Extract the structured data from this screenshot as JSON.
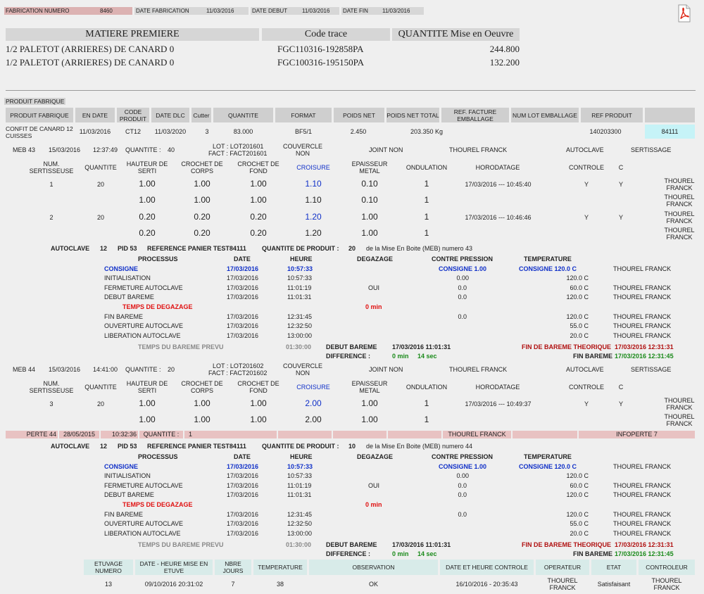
{
  "header": {
    "fab_num_label": "FABRICATION NUMERO",
    "fab_num_value": "8460",
    "date_fab_label": "DATE FABRICATION",
    "date_fab_value": "11/03/2016",
    "date_debut_label": "DATE DEBUT",
    "date_debut_value": "11/03/2016",
    "date_fin_label": "DATE FIN",
    "date_fin_value": "11/03/2016"
  },
  "matiere": {
    "headers": [
      "MATIERE PREMIERE",
      "Code trace",
      "QUANTITE Mise en Oeuvre"
    ],
    "rows": [
      {
        "name": "1/2 PALETOT (ARRIERES) DE CANARD 0",
        "code": "FGC110316-192858PA",
        "qty": "244.800"
      },
      {
        "name": "1/2 PALETOT (ARRIERES) DE CANARD 0",
        "code": "FGC100316-195150PA",
        "qty": "132.200"
      }
    ]
  },
  "produit": {
    "section_label": "PRODUIT FABRIQUE",
    "headers": [
      "PRODUIT FABRIQUE",
      "EN DATE",
      "CODE PRODUIT",
      "DATE DLC",
      "Cutter",
      "QUANTITE",
      "FORMAT",
      "POIDS NET",
      "POIDS NET TOTAL",
      "REF. FACTURE EMBALLAGE",
      "NUM LOT EMBALLAGE",
      "REF PRODUIT",
      ""
    ],
    "row": [
      "CONFIT DE CANARD 12 CUISSES",
      "11/03/2016",
      "CT12",
      "11/03/2020",
      "3",
      "83.000",
      "BF5/1",
      "2.450",
      "203.350 Kg",
      "",
      "",
      "140203300",
      "84111"
    ]
  },
  "meb1": {
    "meb": "MEB 43",
    "date": "15/03/2016",
    "time": "12:37:49",
    "qty_label": "QUANTITE :",
    "qty": "40",
    "lot": "LOT :  LOT201601",
    "fact": "FACT :  FACT201601",
    "couv_label": "COUVERCLE",
    "couv": "NON",
    "joint": "JOINT NON",
    "operator": "THOUREL FRANCK",
    "autoclave": "AUTOCLAVE",
    "sertissage": "SERTISSAGE",
    "headers": [
      "NUM. SERTISSEUSE",
      "QUANTITE",
      "HAUTEUR DE SERTI",
      "CROCHET DE CORPS",
      "CROCHET DE FOND",
      "CROISURE",
      "EPAISSEUR METAL",
      "ONDULATION",
      "HORODATAGE",
      "CONTROLE",
      "C"
    ],
    "rows": [
      [
        "1",
        "20",
        "1.00",
        "1.00",
        "1.00",
        "1.10",
        "0.10",
        "1",
        "17/03/2016 --- 10:45:40",
        "Y",
        "Y",
        "THOUREL FRANCK"
      ],
      [
        "",
        "",
        "1.00",
        "1.00",
        "1.00",
        "1.10",
        "0.10",
        "1",
        "",
        "",
        "",
        "THOUREL FRANCK"
      ],
      [
        "2",
        "20",
        "0.20",
        "0.20",
        "0.20",
        "1.20",
        "1.00",
        "1",
        "17/03/2016 --- 10:46:46",
        "Y",
        "Y",
        "THOUREL FRANCK"
      ],
      [
        "",
        "",
        "0.20",
        "0.20",
        "0.20",
        "1.20",
        "1.00",
        "1",
        "",
        "",
        "",
        "THOUREL FRANCK"
      ]
    ]
  },
  "auto1": {
    "title": [
      "AUTOCLAVE",
      "12",
      "PID 53",
      "REFERENCE PANIER TEST84111",
      "QUANTITE DE PRODUIT :",
      "20",
      "de la Mise En Boite (MEB) numero 43"
    ],
    "headers": [
      "PROCESSUS",
      "DATE",
      "HEURE",
      "DEGAZAGE",
      "CONTRE PRESSION",
      "TEMPERATURE"
    ],
    "rows": [
      [
        "CONSIGNE",
        "17/03/2016",
        "10:57:33",
        "",
        "CONSIGNE 1.00",
        "CONSIGNE 120.0 C",
        "THOUREL FRANCK"
      ],
      [
        "INITIALISATION",
        "17/03/2016",
        "10:57:33",
        "",
        "0.00",
        "120.0 C",
        ""
      ],
      [
        "FERMETURE AUTOCLAVE",
        "17/03/2016",
        "11:01:19",
        "OUI",
        "0.0",
        "60.0 C",
        "THOUREL FRANCK"
      ],
      [
        "DEBUT BAREME",
        "17/03/2016",
        "11:01:31",
        "",
        "0.0",
        "120.0 C",
        "THOUREL FRANCK"
      ],
      [
        "TEMPS DE DEGAZAGE",
        "",
        "",
        "0 min",
        "",
        "",
        ""
      ],
      [
        "FIN BAREME",
        "17/03/2016",
        "12:31:45",
        "",
        "0.0",
        "120.0 C",
        "THOUREL FRANCK"
      ],
      [
        "OUVERTURE AUTOCLAVE",
        "17/03/2016",
        "12:32:50",
        "",
        "",
        "55.0 C",
        "THOUREL FRANCK"
      ],
      [
        "LIBERATION AUTOCLAVE",
        "17/03/2016",
        "13:00:00",
        "",
        "",
        "20.0 C",
        "THOUREL FRANCK"
      ]
    ],
    "bareme_prevu_label": "TEMPS DU BAREME PREVU",
    "bareme_prevu": "01:30:00",
    "debut_label": "DEBUT BAREME",
    "debut": "17/03/2016 11:01:31",
    "fin_theo_label": "FIN DE BAREME THEORIQUE",
    "fin_theo": "17/03/2016 12:31:31",
    "diff_label": "DIFFERENCE :",
    "diff_min": "0 min",
    "diff_sec": "14 sec",
    "fin_label": "FIN BAREME",
    "fin": "17/03/2016 12:31:45"
  },
  "meb2": {
    "meb": "MEB 44",
    "date": "15/03/2016",
    "time": "14:41:00",
    "qty_label": "QUANTITE :",
    "qty": "20",
    "lot": "LOT :  LOT201602",
    "fact": "FACT :  FACT201602",
    "couv_label": "COUVERCLE",
    "couv": "NON",
    "joint": "JOINT NON",
    "operator": "THOUREL FRANCK",
    "autoclave": "AUTOCLAVE",
    "sertissage": "SERTISSAGE",
    "headers": [
      "NUM. SERTISSEUSE",
      "QUANTITE",
      "HAUTEUR DE SERTI",
      "CROCHET DE CORPS",
      "CROCHET DE FOND",
      "CROISURE",
      "EPAISSEUR METAL",
      "ONDULATION",
      "HORODATAGE",
      "CONTROLE",
      "C"
    ],
    "rows": [
      [
        "3",
        "20",
        "1.00",
        "1.00",
        "1.00",
        "2.00",
        "1.00",
        "1",
        "17/03/2016 --- 10:49:37",
        "Y",
        "Y",
        "THOUREL FRANCK"
      ],
      [
        "",
        "",
        "1.00",
        "1.00",
        "1.00",
        "2.00",
        "1.00",
        "1",
        "",
        "",
        "",
        "THOUREL FRANCK"
      ]
    ]
  },
  "perte": {
    "label": "PERTE 44",
    "date": "28/05/2015",
    "time": "10:32:36",
    "qty_label": "QUANTITE :",
    "qty": "1",
    "operator": "THOUREL FRANCK",
    "info": "INFOPERTE 7"
  },
  "auto2": {
    "title": [
      "AUTOCLAVE",
      "12",
      "PID 53",
      "REFERENCE PANIER TEST84111",
      "QUANTITE DE PRODUIT :",
      "10",
      "de la Mise En Boite (MEB) numero 44"
    ],
    "headers": [
      "PROCESSUS",
      "DATE",
      "HEURE",
      "DEGAZAGE",
      "CONTRE PRESSION",
      "TEMPERATURE"
    ],
    "rows": [
      [
        "CONSIGNE",
        "17/03/2016",
        "10:57:33",
        "",
        "CONSIGNE 1.00",
        "CONSIGNE 120.0 C",
        "THOUREL FRANCK"
      ],
      [
        "INITIALISATION",
        "17/03/2016",
        "10:57:33",
        "",
        "0.00",
        "120.0 C",
        ""
      ],
      [
        "FERMETURE AUTOCLAVE",
        "17/03/2016",
        "11:01:19",
        "OUI",
        "0.0",
        "60.0 C",
        "THOUREL FRANCK"
      ],
      [
        "DEBUT BAREME",
        "17/03/2016",
        "11:01:31",
        "",
        "0.0",
        "120.0 C",
        "THOUREL FRANCK"
      ],
      [
        "TEMPS DE DEGAZAGE",
        "",
        "",
        "0 min",
        "",
        "",
        ""
      ],
      [
        "FIN BAREME",
        "17/03/2016",
        "12:31:45",
        "",
        "0.0",
        "120.0 C",
        "THOUREL FRANCK"
      ],
      [
        "OUVERTURE AUTOCLAVE",
        "17/03/2016",
        "12:32:50",
        "",
        "",
        "55.0 C",
        "THOUREL FRANCK"
      ],
      [
        "LIBERATION AUTOCLAVE",
        "17/03/2016",
        "13:00:00",
        "",
        "",
        "20.0 C",
        "THOUREL FRANCK"
      ]
    ],
    "bareme_prevu_label": "TEMPS DU BAREME PREVU",
    "bareme_prevu": "01:30:00",
    "debut_label": "DEBUT BAREME",
    "debut": "17/03/2016 11:01:31",
    "fin_theo_label": "FIN DE BAREME THEORIQUE",
    "fin_theo": "17/03/2016 12:31:31",
    "diff_label": "DIFFERENCE :",
    "diff_min": "0 min",
    "diff_sec": "14 sec",
    "fin_label": "FIN BAREME",
    "fin": "17/03/2016 12:31:45"
  },
  "etuvage": {
    "headers": [
      "ETUVAGE NUMERO",
      "DATE - HEURE MISE EN ETUVE",
      "NBRE JOURS",
      "TEMPERATURE",
      "OBSERVATION",
      "DATE ET HEURE CONTROLE",
      "OPERATEUR",
      "ETAT",
      "CONTROLEUR"
    ],
    "row": [
      "13",
      "09/10/2016 20:31:02",
      "7",
      "38",
      "OK",
      "16/10/2016 - 20:35:43",
      "THOUREL FRANCK",
      "Satisfaisant",
      "THOUREL FRANCK"
    ]
  },
  "icons": {
    "pdf": "pdf-icon"
  }
}
